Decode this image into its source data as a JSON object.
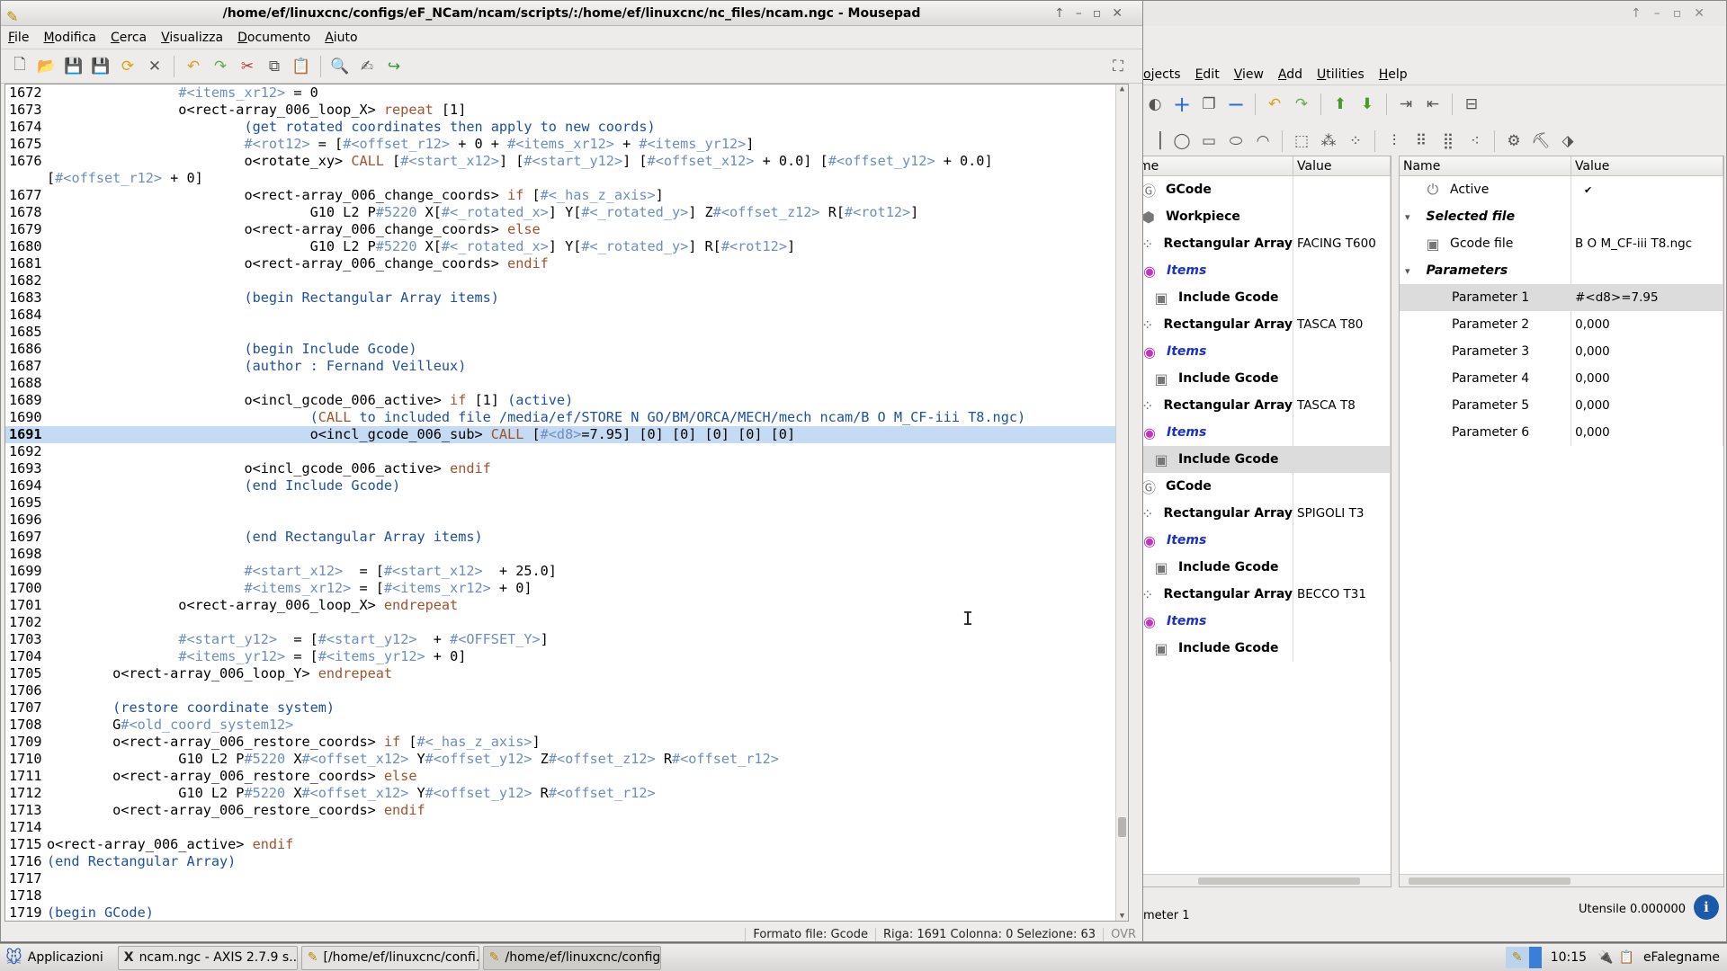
{
  "mousepad": {
    "title": "/home/ef/linuxcnc/configs/eF_NCam/ncam/scripts/:/home/ef/linuxcnc/nc_files/ncam.ngc - Mousepad",
    "menu": [
      "File",
      "Modifica",
      "Cerca",
      "Visualizza",
      "Documento",
      "Aiuto"
    ],
    "status": {
      "format": "Formato file: Gcode",
      "position": "Riga: 1691 Colonna: 0 Selezione: 63",
      "mode": "OVR"
    },
    "highlight_line": "1691",
    "lines": [
      {
        "n": "1672",
        "t": "                #<items_xr12> = 0"
      },
      {
        "n": "1673",
        "t": "                o<rect-array_006_loop_X> repeat [1]"
      },
      {
        "n": "1674",
        "t": "                        (get rotated coordinates then apply to new coords)"
      },
      {
        "n": "1675",
        "t": "                        #<rot12> = [#<offset_r12> + 0 + #<items_xr12> + #<items_yr12>]"
      },
      {
        "n": "1676",
        "t": "                        o<rotate_xy> CALL [#<start_x12>] [#<start_y12>] [#<offset_x12> + 0.0] [#<offset_y12> + 0.0]"
      },
      {
        "n": "",
        "t": "[#<offset_r12> + 0]"
      },
      {
        "n": "1677",
        "t": "                        o<rect-array_006_change_coords> if [#<_has_z_axis>]"
      },
      {
        "n": "1678",
        "t": "                                G10 L2 P#5220 X[#<_rotated_x>] Y[#<_rotated_y>] Z#<offset_z12> R[#<rot12>]"
      },
      {
        "n": "1679",
        "t": "                        o<rect-array_006_change_coords> else"
      },
      {
        "n": "1680",
        "t": "                                G10 L2 P#5220 X[#<_rotated_x>] Y[#<_rotated_y>] R[#<rot12>]"
      },
      {
        "n": "1681",
        "t": "                        o<rect-array_006_change_coords> endif"
      },
      {
        "n": "1682",
        "t": ""
      },
      {
        "n": "1683",
        "t": "                        (begin Rectangular Array items)"
      },
      {
        "n": "1684",
        "t": ""
      },
      {
        "n": "1685",
        "t": ""
      },
      {
        "n": "1686",
        "t": "                        (begin Include Gcode)"
      },
      {
        "n": "1687",
        "t": "                        (author : Fernand Veilleux)"
      },
      {
        "n": "1688",
        "t": ""
      },
      {
        "n": "1689",
        "t": "                        o<incl_gcode_006_active> if [1] (active)"
      },
      {
        "n": "1690",
        "t": "                                (CALL to included file /media/ef/STORE N GO/BM/ORCA/MECH/mech ncam/B O M_CF-iii T8.ngc)"
      },
      {
        "n": "1691",
        "t": "                                o<incl_gcode_006_sub> CALL [#<d8>=7.95] [0] [0] [0] [0] [0]"
      },
      {
        "n": "1692",
        "t": ""
      },
      {
        "n": "1693",
        "t": "                        o<incl_gcode_006_active> endif"
      },
      {
        "n": "1694",
        "t": "                        (end Include Gcode)"
      },
      {
        "n": "1695",
        "t": ""
      },
      {
        "n": "1696",
        "t": ""
      },
      {
        "n": "1697",
        "t": "                        (end Rectangular Array items)"
      },
      {
        "n": "1698",
        "t": ""
      },
      {
        "n": "1699",
        "t": "                        #<start_x12>  = [#<start_x12>  + 25.0]"
      },
      {
        "n": "1700",
        "t": "                        #<items_xr12> = [#<items_xr12> + 0]"
      },
      {
        "n": "1701",
        "t": "                o<rect-array_006_loop_X> endrepeat"
      },
      {
        "n": "1702",
        "t": ""
      },
      {
        "n": "1703",
        "t": "                #<start_y12>  = [#<start_y12>  + #<OFFSET_Y>]"
      },
      {
        "n": "1704",
        "t": "                #<items_yr12> = [#<items_yr12> + 0]"
      },
      {
        "n": "1705",
        "t": "        o<rect-array_006_loop_Y> endrepeat"
      },
      {
        "n": "1706",
        "t": ""
      },
      {
        "n": "1707",
        "t": "        (restore coordinate system)"
      },
      {
        "n": "1708",
        "t": "        G#<old_coord_system12>"
      },
      {
        "n": "1709",
        "t": "        o<rect-array_006_restore_coords> if [#<_has_z_axis>]"
      },
      {
        "n": "1710",
        "t": "                G10 L2 P#5220 X#<offset_x12> Y#<offset_y12> Z#<offset_z12> R#<offset_r12>"
      },
      {
        "n": "1711",
        "t": "        o<rect-array_006_restore_coords> else"
      },
      {
        "n": "1712",
        "t": "                G10 L2 P#5220 X#<offset_x12> Y#<offset_y12> R#<offset_r12>"
      },
      {
        "n": "1713",
        "t": "        o<rect-array_006_restore_coords> endif"
      },
      {
        "n": "1714",
        "t": ""
      },
      {
        "n": "1715",
        "t": "o<rect-array_006_active> endif"
      },
      {
        "n": "1716",
        "t": "(end Rectangular Array)"
      },
      {
        "n": "1717",
        "t": ""
      },
      {
        "n": "1718",
        "t": ""
      },
      {
        "n": "1719",
        "t": "(begin GCode)"
      }
    ]
  },
  "ncam": {
    "menu": [
      "ojects",
      "Edit",
      "View",
      "Add",
      "Utilities",
      "Help"
    ],
    "tree_headers": {
      "name": "me",
      "value": "Value"
    },
    "tree": [
      {
        "name": "GCode",
        "value": "",
        "icon": "gcode-icon",
        "style": "bold"
      },
      {
        "name": "Workpiece",
        "value": "",
        "icon": "workpiece-icon",
        "style": "bold"
      },
      {
        "name": "Rectangular Array",
        "value": "FACING T600",
        "icon": "array-icon",
        "style": "bold"
      },
      {
        "name": "Items",
        "value": "",
        "icon": "items-icon",
        "style": "items"
      },
      {
        "name": "Include Gcode",
        "value": "",
        "icon": "include-icon",
        "style": "bold-indent"
      },
      {
        "name": "Rectangular Array",
        "value": "TASCA T80",
        "icon": "array-icon",
        "style": "bold"
      },
      {
        "name": "Items",
        "value": "",
        "icon": "items-icon",
        "style": "items"
      },
      {
        "name": "Include Gcode",
        "value": "",
        "icon": "include-icon",
        "style": "bold-indent"
      },
      {
        "name": "Rectangular Array",
        "value": "TASCA T8",
        "icon": "array-icon",
        "style": "bold"
      },
      {
        "name": "Items",
        "value": "",
        "icon": "items-icon",
        "style": "items"
      },
      {
        "name": "Include Gcode",
        "value": "",
        "icon": "include-icon",
        "style": "bold-indent-sel"
      },
      {
        "name": "GCode",
        "value": "",
        "icon": "gcode-icon",
        "style": "bold"
      },
      {
        "name": "Rectangular Array",
        "value": "SPIGOLI T3",
        "icon": "array-icon",
        "style": "bold"
      },
      {
        "name": "Items",
        "value": "",
        "icon": "items-icon",
        "style": "items"
      },
      {
        "name": "Include Gcode",
        "value": "",
        "icon": "include-icon",
        "style": "bold-indent"
      },
      {
        "name": "Rectangular Array",
        "value": "BECCO T31",
        "icon": "array-icon",
        "style": "bold"
      },
      {
        "name": "Items",
        "value": "",
        "icon": "items-icon",
        "style": "items"
      },
      {
        "name": "Include Gcode",
        "value": "",
        "icon": "include-icon",
        "style": "bold-indent"
      }
    ],
    "props_headers": {
      "name": "Name",
      "value": "Value"
    },
    "props": [
      {
        "name": "Active",
        "value": "✔",
        "type": "active"
      },
      {
        "name": "Selected file",
        "value": "",
        "type": "section"
      },
      {
        "name": "Gcode file",
        "value": "B O M_CF-iii T8.ngc",
        "type": "file"
      },
      {
        "name": "Parameters",
        "value": "",
        "type": "section"
      },
      {
        "name": "Parameter 1",
        "value": "#<d8>=7.95",
        "type": "param-sel"
      },
      {
        "name": "Parameter 2",
        "value": "0,000",
        "type": "param"
      },
      {
        "name": "Parameter 3",
        "value": "0,000",
        "type": "param"
      },
      {
        "name": "Parameter 4",
        "value": "0,000",
        "type": "param"
      },
      {
        "name": "Parameter 5",
        "value": "0,000",
        "type": "param"
      },
      {
        "name": "Parameter 6",
        "value": "0,000",
        "type": "param"
      }
    ],
    "bottom_left": "ameter 1",
    "tool": "Utensile 0.000000"
  },
  "taskbar": {
    "start": "Applicazioni",
    "tasks": [
      "ncam.ngc - AXIS 2.7.9 s...",
      "[/home/ef/linuxcnc/confi...",
      "/home/ef/linuxcnc/config..."
    ],
    "clock": "10:15",
    "user": "eFalegname"
  },
  "colors": {
    "keyword": "#a0522d",
    "comment": "#1e50a0",
    "var": "#6c8ebf",
    "addr": "#a00000",
    "highlight": "#c5dbf4"
  }
}
